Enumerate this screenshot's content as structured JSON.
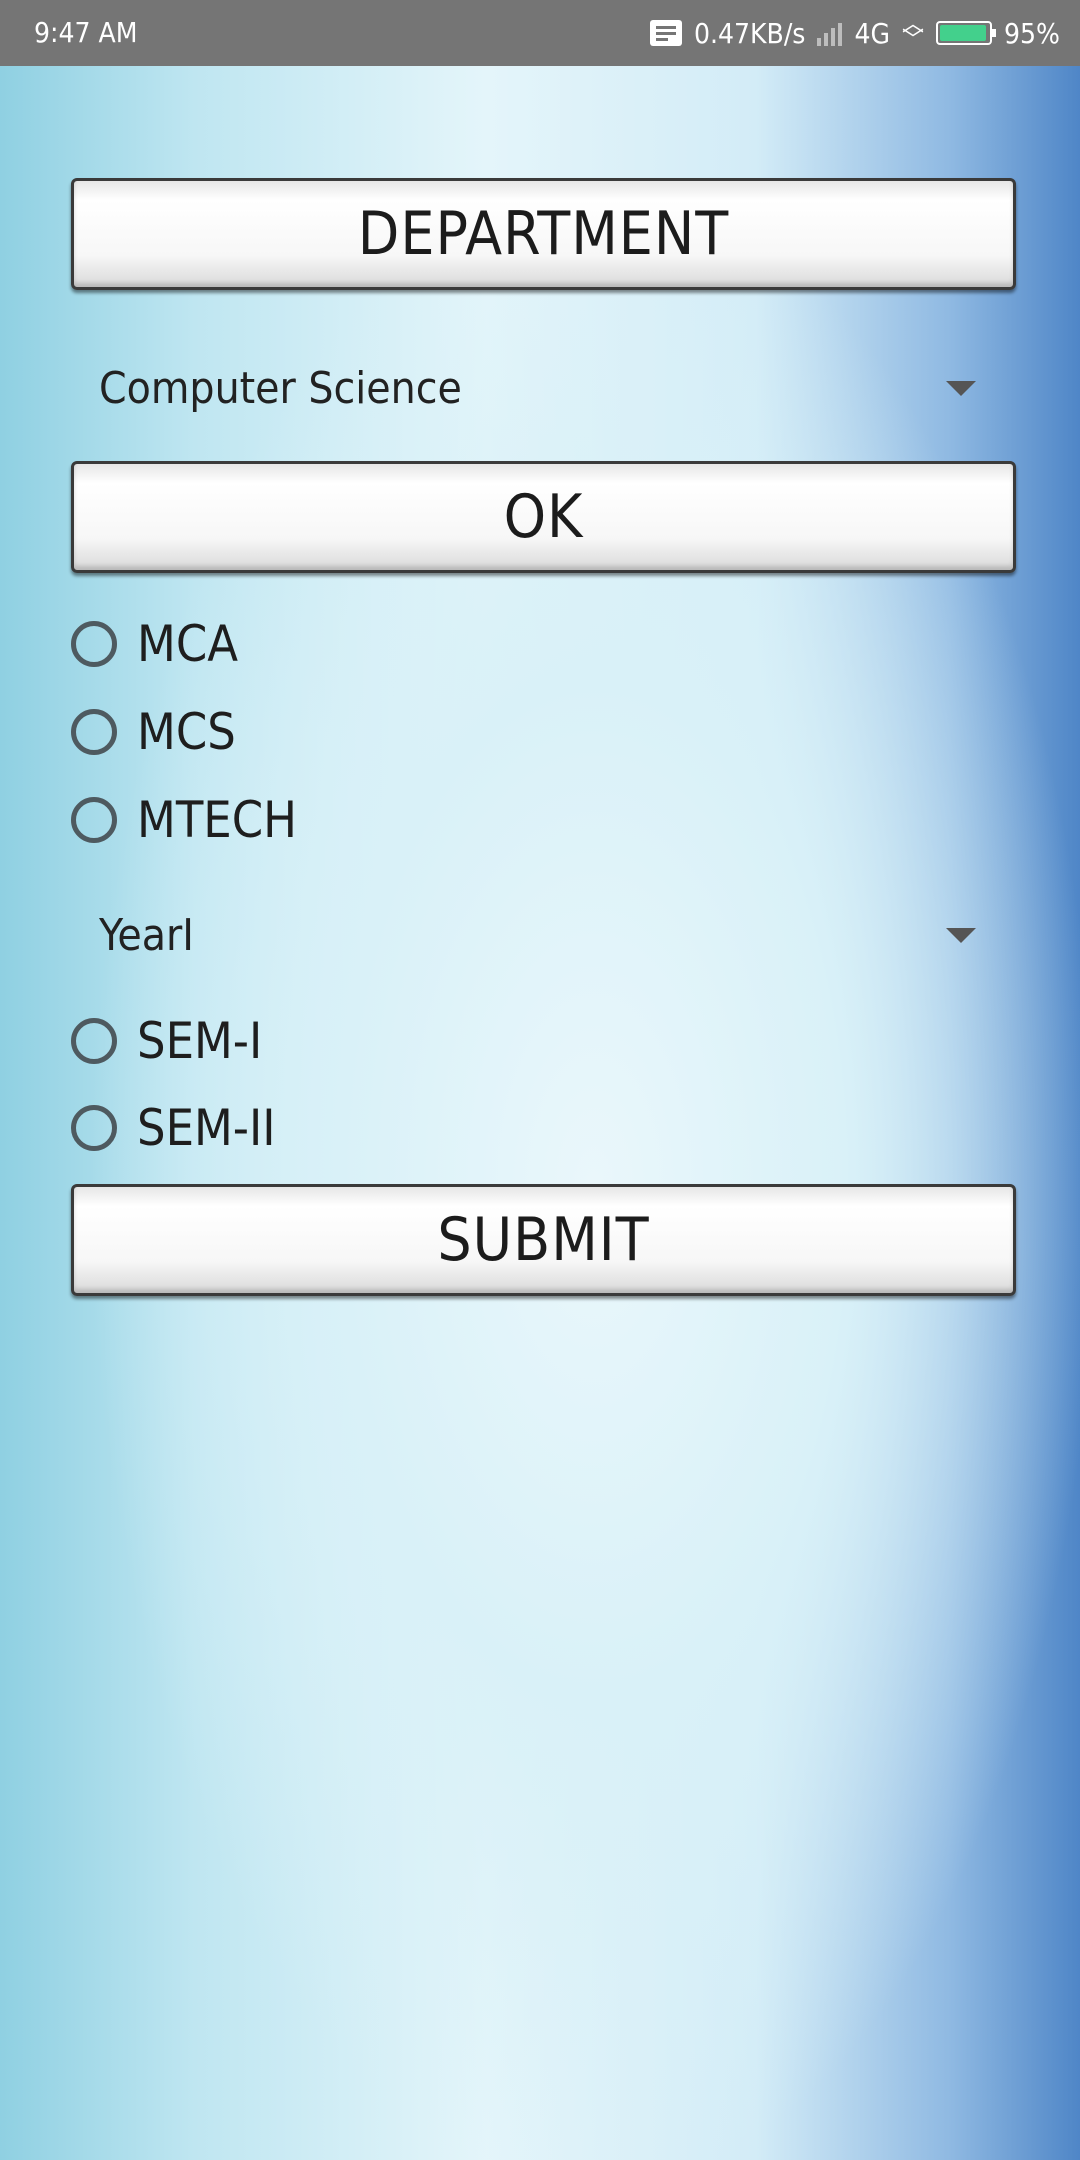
{
  "status_bar": {
    "time": "9:47 AM",
    "network_speed": "0.47KB/s",
    "network_type": "4G",
    "battery_percent": "95%",
    "battery_level": 0.95,
    "battery_color": "#43d08c",
    "icons": [
      "message-icon",
      "signal-icon",
      "data-arrows-icon",
      "battery-icon"
    ]
  },
  "form": {
    "department_button": "DEPARTMENT",
    "department_spinner": {
      "selected": "Computer Science"
    },
    "ok_button": "OK",
    "course_options": [
      "MCA",
      "MCS",
      "MTECH"
    ],
    "year_spinner": {
      "selected": "YearI"
    },
    "semester_options": [
      "SEM-I",
      "SEM-II"
    ],
    "submit_button": "SUBMIT"
  }
}
